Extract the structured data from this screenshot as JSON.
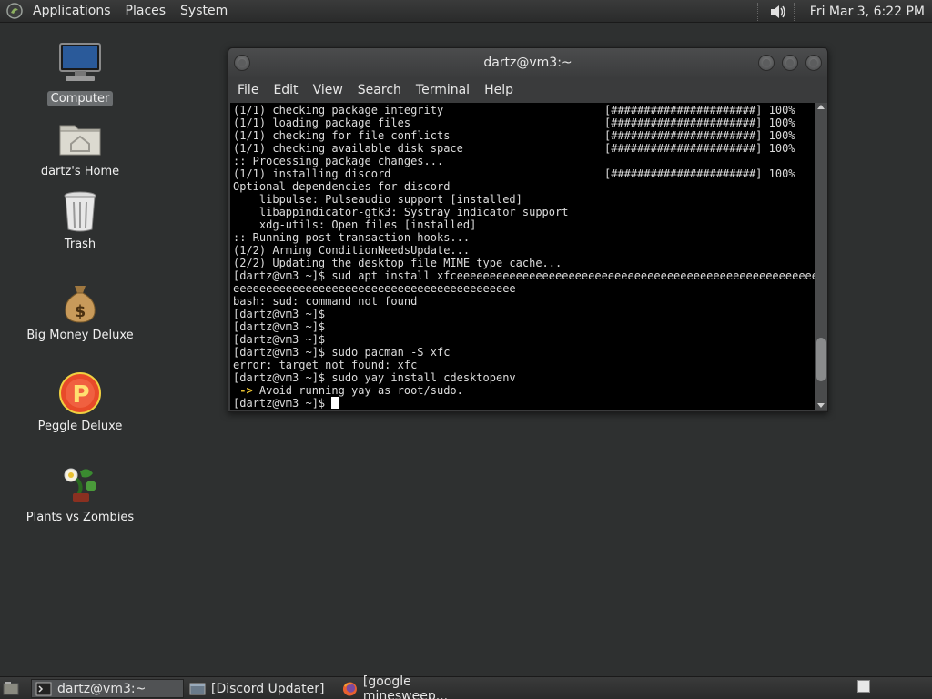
{
  "top_panel": {
    "menus": [
      "Applications",
      "Places",
      "System"
    ],
    "clock": "Fri Mar  3,  6:22 PM",
    "icons": {
      "logo": "gnome-foot-icon",
      "volume": "volume-icon"
    }
  },
  "desktop": {
    "icons": [
      {
        "label": "Computer",
        "icon": "computer-icon",
        "selected": true
      },
      {
        "label": "dartz's Home",
        "icon": "home-folder-icon"
      },
      {
        "label": "Trash",
        "icon": "trash-icon"
      },
      {
        "label": "Big Money Deluxe",
        "icon": "money-bag-icon"
      },
      {
        "label": "Peggle Deluxe",
        "icon": "peggle-icon"
      },
      {
        "label": "Plants vs Zombies",
        "icon": "plants-zombies-icon"
      }
    ]
  },
  "terminal": {
    "title": "dartz@vm3:~",
    "menu": [
      "File",
      "Edit",
      "View",
      "Search",
      "Terminal",
      "Help"
    ],
    "lines": [
      {
        "text": "(1/1) checking package integrity",
        "progress": "[######################] 100%"
      },
      {
        "text": "(1/1) loading package files",
        "progress": "[######################] 100%"
      },
      {
        "text": "(1/1) checking for file conflicts",
        "progress": "[######################] 100%"
      },
      {
        "text": "(1/1) checking available disk space",
        "progress": "[######################] 100%"
      },
      {
        "text": ":: Processing package changes..."
      },
      {
        "text": "(1/1) installing discord",
        "progress": "[######################] 100%"
      },
      {
        "text": "Optional dependencies for discord"
      },
      {
        "text": "    libpulse: Pulseaudio support [installed]"
      },
      {
        "text": "    libappindicator-gtk3: Systray indicator support"
      },
      {
        "text": "    xdg-utils: Open files [installed]"
      },
      {
        "text": ":: Running post-transaction hooks..."
      },
      {
        "text": "(1/2) Arming ConditionNeedsUpdate..."
      },
      {
        "text": "(2/2) Updating the desktop file MIME type cache..."
      },
      {
        "text": "[dartz@vm3 ~]$ sud apt install xfceeeeeeeeeeeeeeeeeeeeeeeeeeeeeeeeeeeeeeeeeeeeeeeeeeeeeeee"
      },
      {
        "text": "eeeeeeeeeeeeeeeeeeeeeeeeeeeeeeeeeeeeeeeeeee"
      },
      {
        "text": "bash: sud: command not found"
      },
      {
        "text": "[dartz@vm3 ~]$"
      },
      {
        "text": "[dartz@vm3 ~]$"
      },
      {
        "text": "[dartz@vm3 ~]$"
      },
      {
        "text": "[dartz@vm3 ~]$ sudo pacman -S xfc"
      },
      {
        "text": "error: target not found: xfc"
      },
      {
        "text": "[dartz@vm3 ~]$ sudo yay install cdesktopenv"
      },
      {
        "arrow": " ->",
        "text": " Avoid running yay as root/sudo."
      },
      {
        "text": "[dartz@vm3 ~]$ ",
        "cursor": true
      }
    ],
    "scroll_position": 0.92
  },
  "taskbar": {
    "tasks": [
      {
        "label": "dartz@vm3:~",
        "icon": "terminal-icon",
        "active": true
      },
      {
        "label": "[Discord Updater]",
        "icon": "window-icon"
      },
      {
        "label": "[google minesweep...",
        "icon": "firefox-icon"
      }
    ]
  },
  "colors": {
    "panel": "#2e2f2f",
    "desktop": "#2e3030",
    "terminal_bg": "#000000",
    "accent_arrow": "#e8c030"
  }
}
